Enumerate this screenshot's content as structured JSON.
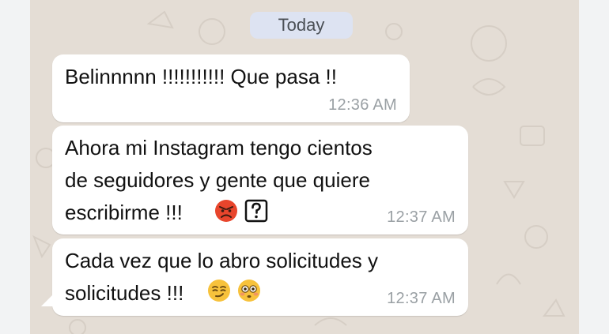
{
  "chat": {
    "date_separator": "Today",
    "messages": [
      {
        "text": "Belinnnnn  !!!!!!!!!!! Que pasa !!",
        "time": "12:36 AM",
        "emojis": []
      },
      {
        "text": "Ahora mi Instagram tengo cientos\nde seguidores y gente que quiere\nescribirme !!!",
        "time": "12:37 AM",
        "emojis": [
          "angry-face-icon",
          "question-box-icon"
        ]
      },
      {
        "text": "Cada vez que lo abro solicitudes y\nsolicitudes !!!",
        "time": "12:37 AM",
        "emojis": [
          "smirking-face-icon",
          "flushed-face-icon"
        ]
      }
    ]
  },
  "colors": {
    "wallpaper": "#e4ddd5",
    "bubble": "#ffffff",
    "date_pill": "#dde3f2",
    "timestamp": "#9aa0a4"
  }
}
